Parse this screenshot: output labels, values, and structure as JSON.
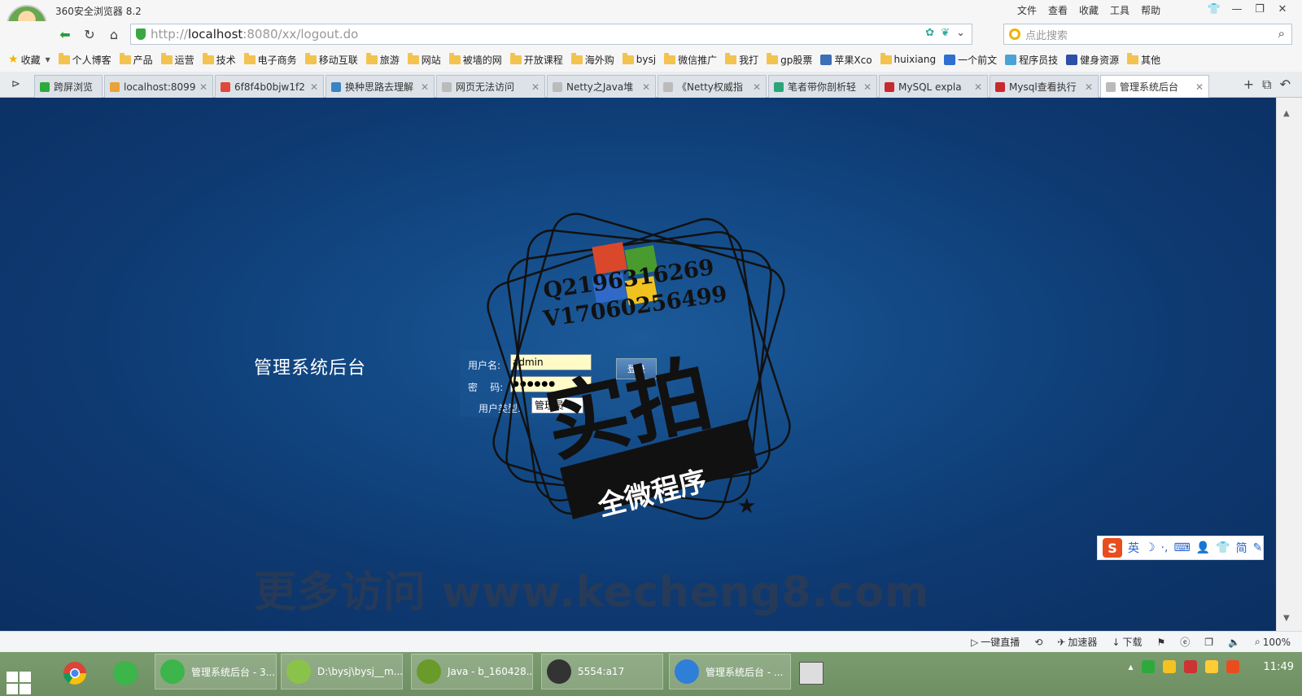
{
  "browser": {
    "app_title": "360安全浏览器 8.2",
    "menu": [
      "文件",
      "查看",
      "收藏",
      "工具",
      "帮助"
    ],
    "url_host": "localhost",
    "url_prefix": "http://",
    "url_rest": ":8080/xx/logout.do",
    "search_placeholder": "点此搜索"
  },
  "bookmarks": {
    "fav_label": "收藏",
    "items": [
      "个人博客",
      "产品",
      "运营",
      "技术",
      "电子商务",
      "移动互联",
      "旅游",
      "网站",
      "被墙的网",
      "开放课程",
      "海外购",
      "bysj",
      "微信推广",
      "我打",
      "gp股票",
      "苹果Xco",
      "huixiang",
      "一个前文",
      "程序员技",
      "健身资源",
      "其他"
    ]
  },
  "tabs": [
    {
      "label": "跨屏浏览",
      "color": "#2eaa3c"
    },
    {
      "label": "localhost:8099",
      "color": "#e8a33c"
    },
    {
      "label": "6f8f4b0bjw1f2",
      "color": "#e0473a"
    },
    {
      "label": "换种思路去理解",
      "color": "#3b82c4"
    },
    {
      "label": "网页无法访问",
      "color": "#bbbbbb"
    },
    {
      "label": "Netty之Java堆",
      "color": "#bbbbbb"
    },
    {
      "label": "《Netty权威指",
      "color": "#bbbbbb"
    },
    {
      "label": "笔者带你剖析轻",
      "color": "#2aa57a"
    },
    {
      "label": "MySQL expla",
      "color": "#c8292e"
    },
    {
      "label": "Mysql查看执行",
      "color": "#c8292e"
    },
    {
      "label": "管理系统后台",
      "color": "#bbbbbb",
      "active": true
    }
  ],
  "page": {
    "system_title": "管理系统后台",
    "username_label": "用户名:",
    "username_value": "admin",
    "password_label": "密    码:",
    "password_value": "●●●●●●",
    "usertype_label": "用户类型:",
    "usertype_value": "管理员",
    "login_button": "登录"
  },
  "overlay": {
    "stamp_line1": "Q2196316269",
    "stamp_line2": "V17060256499",
    "stamp_main": "实拍",
    "stamp_banner": "全微程序",
    "watermark": "更多访问 www.kecheng8.com",
    "ime_items": [
      "英",
      "☽",
      "·,",
      "⌨",
      "简"
    ]
  },
  "statusbar": [
    "一键直播",
    "加速器",
    "下载",
    "100%"
  ],
  "taskbar": {
    "tasks": [
      {
        "label": "管理系统后台 - 3...",
        "color": "#3cb54a"
      },
      {
        "label": "D:\\bysj\\bysj__m...",
        "color": "#8bc34a"
      },
      {
        "label": "Java - b_160428...",
        "color": "#6a9a2a"
      },
      {
        "label": "5554:a17",
        "color": "#333333"
      },
      {
        "label": "管理系统后台 - ...",
        "color": "#2f7fd8"
      }
    ],
    "clock": "11:49"
  }
}
